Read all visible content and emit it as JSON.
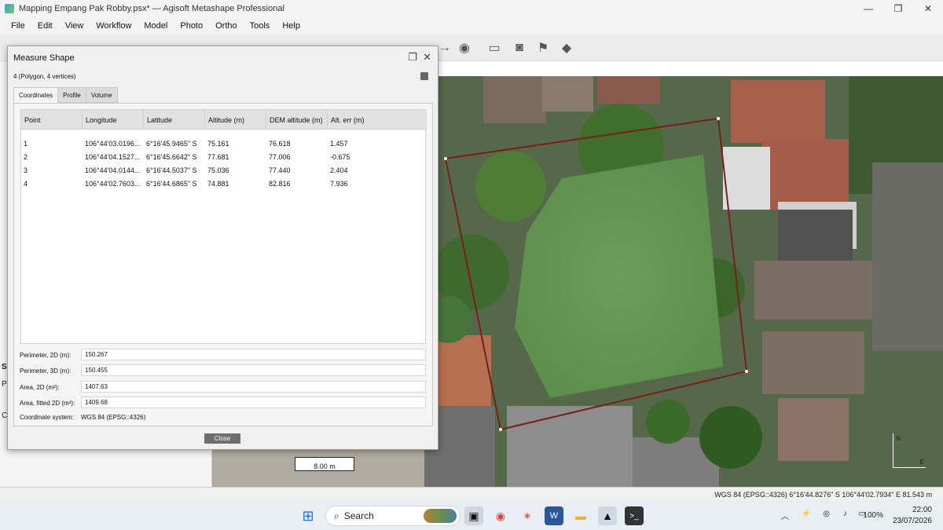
{
  "window": {
    "title": "Mapping Empang Pak Robby.psx* — Agisoft Metashape Professional",
    "controls": [
      "—",
      "❐",
      "✕"
    ]
  },
  "menu": [
    "File",
    "Edit",
    "View",
    "Workflow",
    "Model",
    "Photo",
    "Ortho",
    "Tools",
    "Help"
  ],
  "left_panel_fragments": [
    "S",
    "Pr",
    "C"
  ],
  "dialog": {
    "title": "Measure Shape",
    "subtitle": "4 (Polygon, 4 vertices)",
    "tabs": [
      "Coordinates",
      "Profile",
      "Volume"
    ],
    "columns": [
      "Point",
      "Longitude",
      "Latitude",
      "Altitude (m)",
      "DEM altitude (m)",
      "Alt. err (m)"
    ],
    "rows": [
      [
        "1",
        "106°44'03.0196...",
        "6°16'45.9465\" S",
        "75.161",
        "76.618",
        "1.457"
      ],
      [
        "2",
        "106°44'04.1527...",
        "6°16'45.6642\" S",
        "77.681",
        "77.006",
        "-0.675"
      ],
      [
        "3",
        "106°44'04.0144...",
        "6°16'44.5037\" S",
        "75.036",
        "77.440",
        "2.404"
      ],
      [
        "4",
        "106°44'02.7603...",
        "6°16'44.6865\" S",
        "74.881",
        "82.816",
        "7.936"
      ]
    ],
    "fields": [
      {
        "label": "Perimeter, 2D (m):",
        "value": "150.267"
      },
      {
        "label": "Perimeter, 3D (m):",
        "value": "150.455"
      },
      {
        "label": "Area, 2D (m²):",
        "value": "1407.63"
      },
      {
        "label": "Area, fitted 2D (m²):",
        "value": "1409.68"
      }
    ],
    "coordinate_system_label": "Coordinate system:",
    "coordinate_system_value": "WGS 84 (EPSG::4326)",
    "close_label": "Close"
  },
  "map": {
    "scale_label": "8.00 m",
    "compass_n": "N",
    "compass_e": "E"
  },
  "status": {
    "coords": "WGS 84 (EPSG::4326)   6°16'44.8276\" S   106°44'02.7934\" E   81.543 m"
  },
  "taskbar": {
    "search_label": "Search",
    "battery": "100%",
    "time": "22:00",
    "date": "23/07/2026"
  }
}
